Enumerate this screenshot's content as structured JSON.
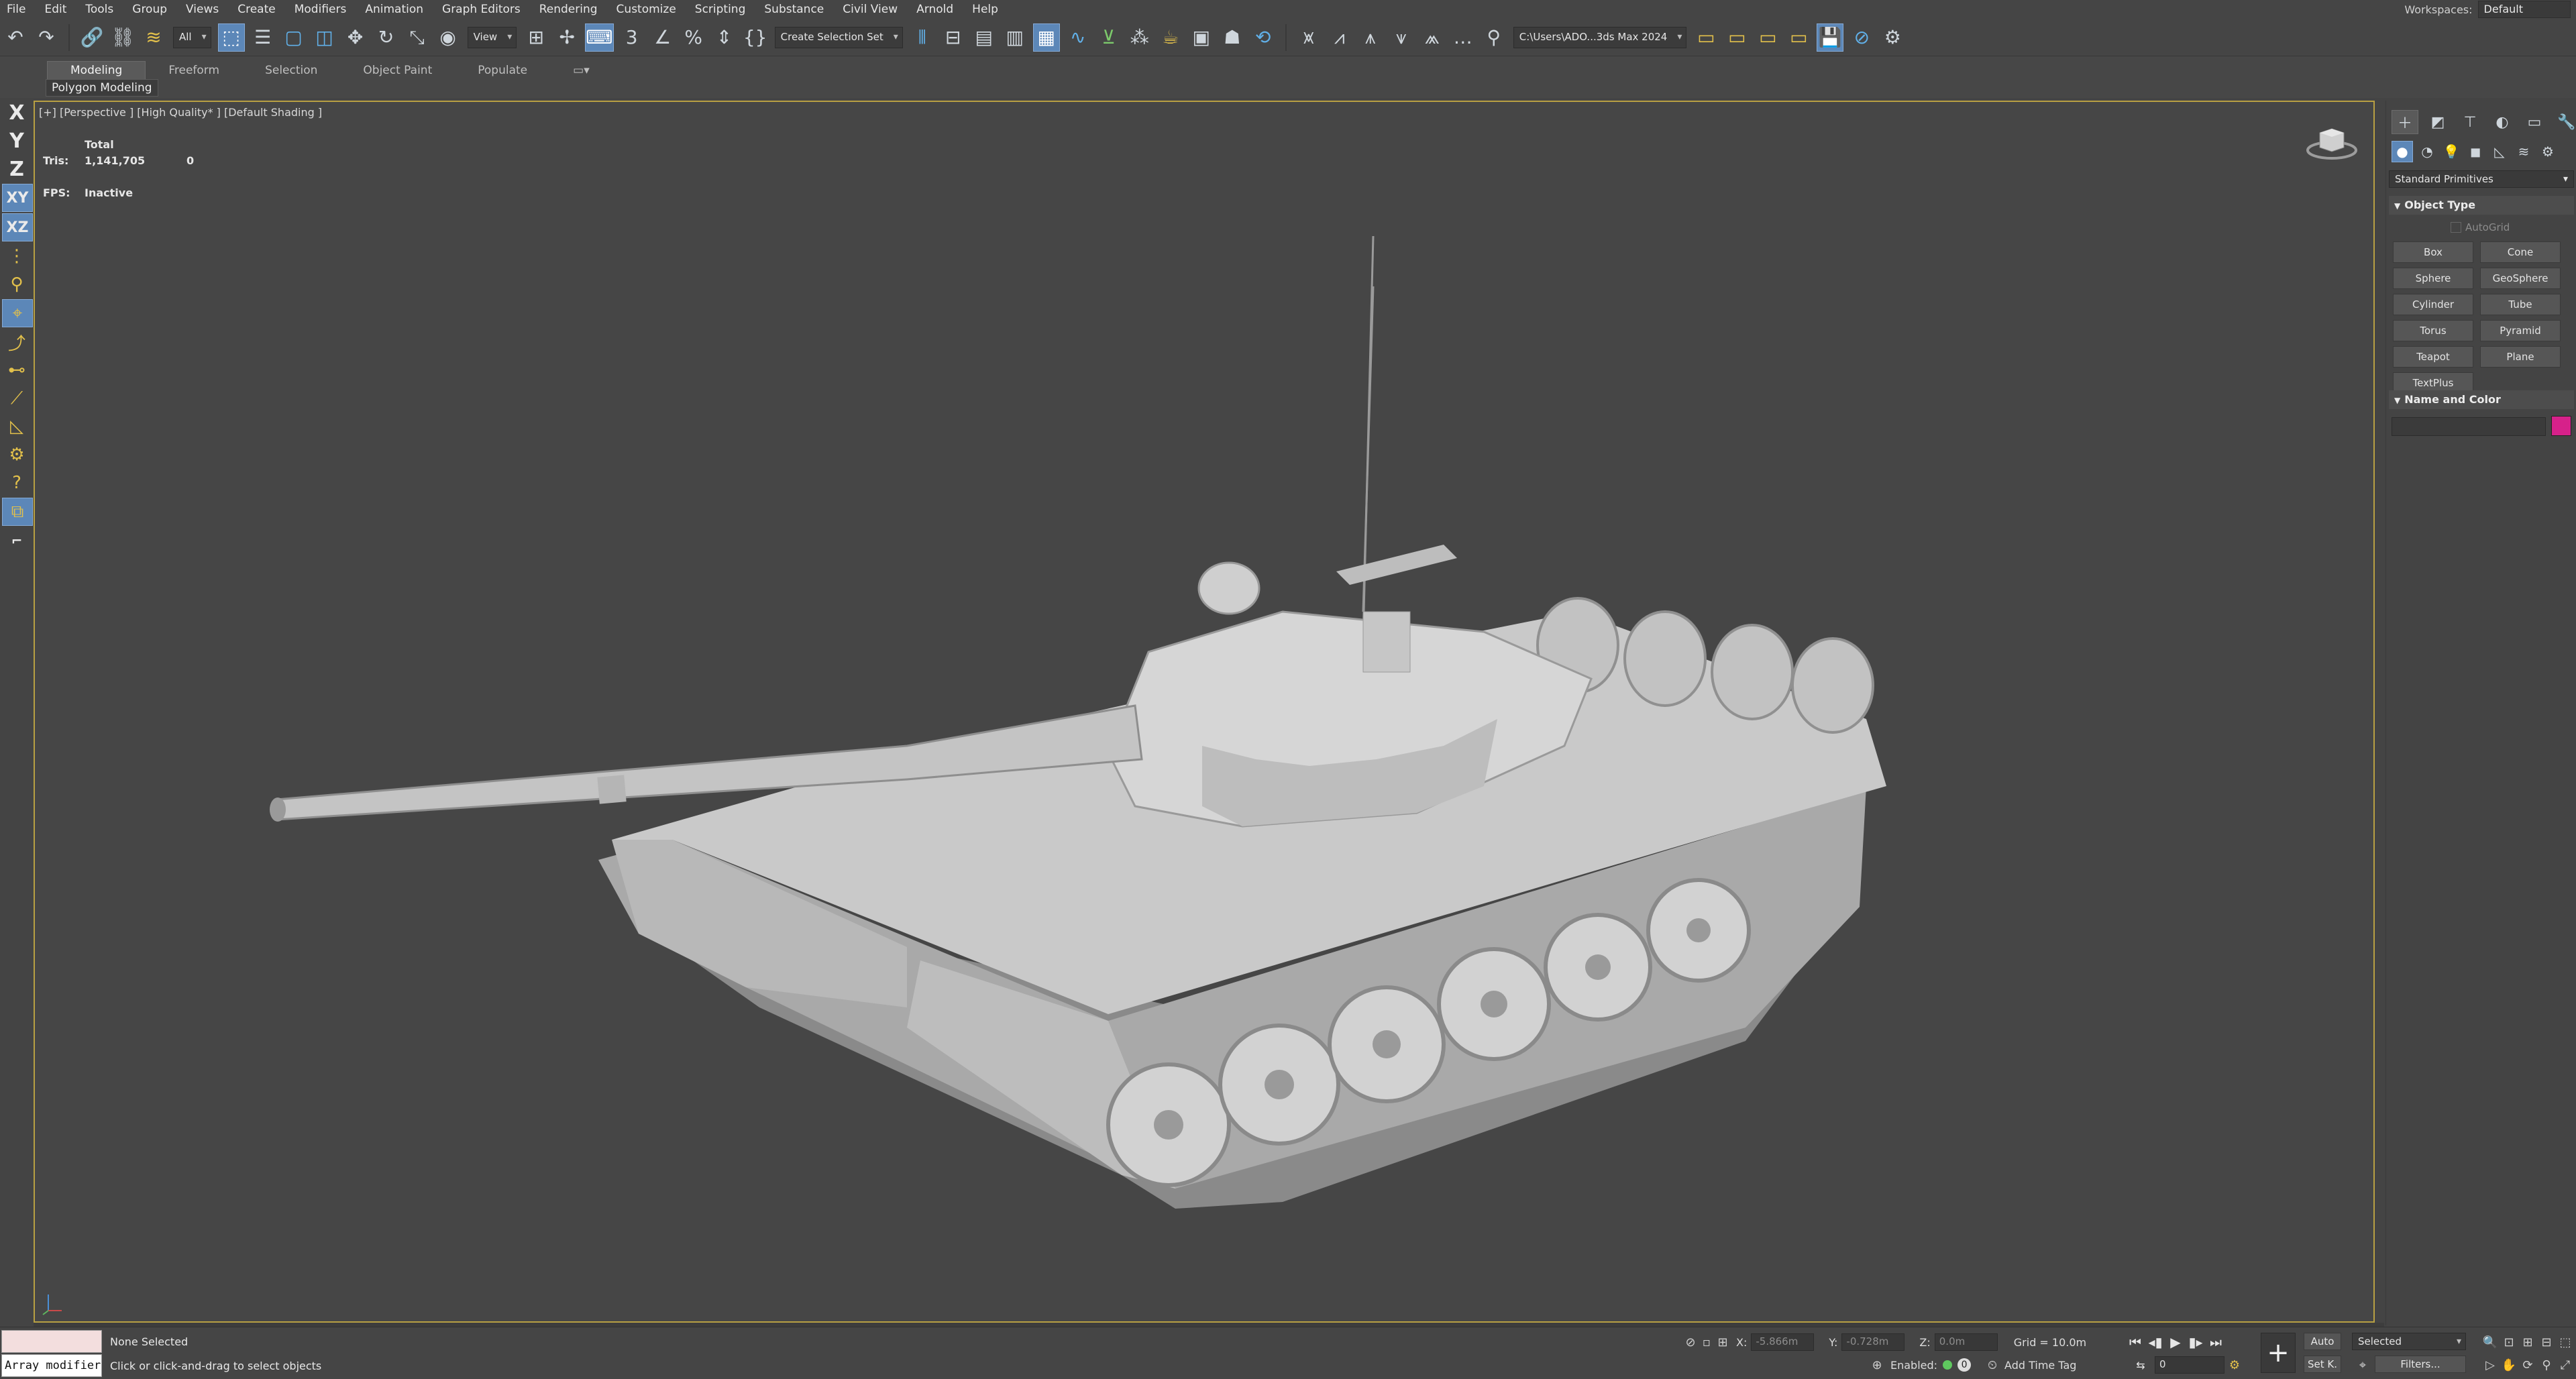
{
  "menu": [
    "File",
    "Edit",
    "Tools",
    "Group",
    "Views",
    "Create",
    "Modifiers",
    "Animation",
    "Graph Editors",
    "Rendering",
    "Customize",
    "Scripting",
    "Substance",
    "Civil View",
    "Arnold",
    "Help"
  ],
  "workspace": {
    "label": "Workspaces:",
    "value": "Default"
  },
  "toolbar": {
    "selection_filter": "All",
    "ref_coord": "View",
    "named_selection": "Create Selection Set",
    "project_path": "C:\\Users\\ADO...3ds Max 2024"
  },
  "ribbon": {
    "tabs": [
      "Modeling",
      "Freeform",
      "Selection",
      "Object Paint",
      "Populate"
    ],
    "sub": "Polygon Modeling"
  },
  "axis_constraints": {
    "x": "X",
    "y": "Y",
    "z": "Z",
    "xy": "XY",
    "xz": "XZ"
  },
  "viewport": {
    "label": "[+] [Perspective ] [High Quality* ] [Default Shading ]",
    "stats_header": "Total",
    "tris_label": "Tris:",
    "tris_total": "1,141,705",
    "tris_sel": "0",
    "fps_label": "FPS:",
    "fps_value": "Inactive"
  },
  "command_panel": {
    "dropdown": "Standard Primitives",
    "object_type_title": "Object Type",
    "autogrid": "AutoGrid",
    "objects": [
      "Box",
      "Cone",
      "Sphere",
      "GeoSphere",
      "Cylinder",
      "Tube",
      "Torus",
      "Pyramid",
      "Teapot",
      "Plane",
      "TextPlus"
    ],
    "name_color_title": "Name and Color",
    "swatch_color": "#d6218a"
  },
  "status": {
    "listener": "Array modifier",
    "selection": "None Selected",
    "prompt": "Click or click-and-drag to select objects",
    "x_label": "X:",
    "x_value": "-5.866m",
    "y_label": "Y:",
    "y_value": "-0.728m",
    "z_label": "Z:",
    "z_value": "0.0m",
    "grid": "Grid = 10.0m",
    "enabled_label": "Enabled:",
    "enabled_value": "0",
    "add_time_tag": "Add Time Tag",
    "auto": "Auto",
    "set_key": "Set K.",
    "key_mode": "Selected",
    "frame": "0",
    "filters": "Filters..."
  }
}
